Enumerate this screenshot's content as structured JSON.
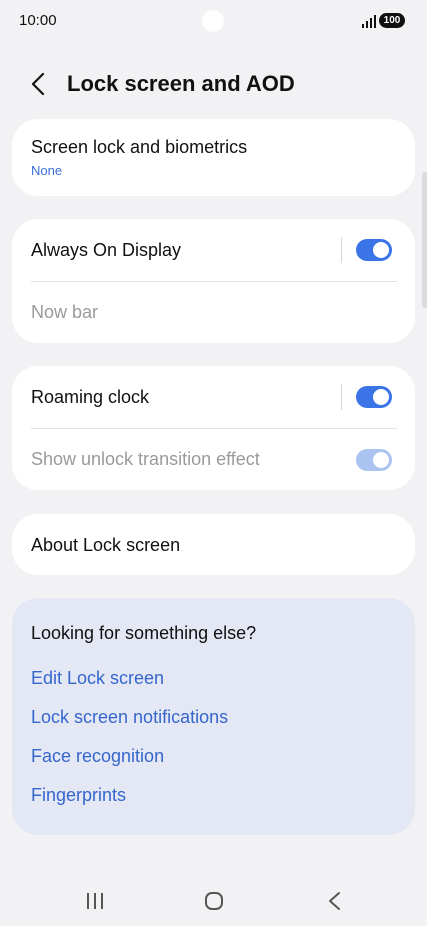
{
  "status_bar": {
    "time": "10:00",
    "battery": "100",
    "icons": [
      "signal-icon",
      "battery-icon"
    ]
  },
  "header": {
    "back_icon": "back-icon",
    "title": "Lock screen and AOD"
  },
  "cards": {
    "screen_lock": {
      "title": "Screen lock and biometrics",
      "subtitle": "None"
    },
    "aod": {
      "title": "Always On Display",
      "toggle_on": true,
      "now_bar": "Now bar"
    },
    "roaming": {
      "title": "Roaming clock",
      "toggle_on": true,
      "unlock_effect": "Show unlock transition effect",
      "unlock_effect_on": true
    },
    "about": {
      "title": "About Lock screen"
    }
  },
  "suggestions": {
    "title": "Looking for something else?",
    "links": [
      "Edit Lock screen",
      "Lock screen notifications",
      "Face recognition",
      "Fingerprints"
    ]
  },
  "colors": {
    "accent": "#3b74e6",
    "link": "#3566cc",
    "background": "#f2f2f4",
    "suggest_bg": "#e4e8f4"
  },
  "navbar": {
    "icons": [
      "recents-icon",
      "home-icon",
      "back-nav-icon"
    ]
  }
}
